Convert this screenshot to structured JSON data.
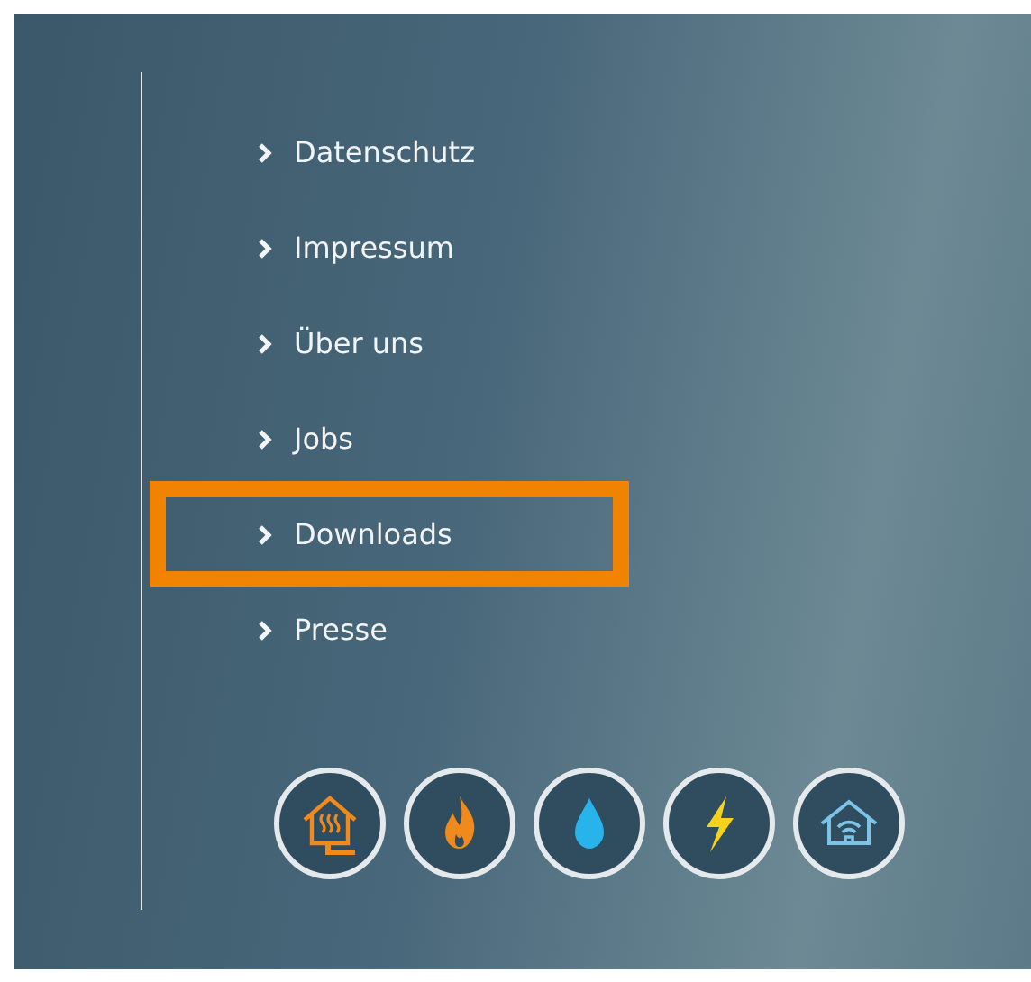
{
  "footer_links": [
    {
      "label": "Datenschutz",
      "highlighted": false
    },
    {
      "label": "Impressum",
      "highlighted": false
    },
    {
      "label": "Über uns",
      "highlighted": false
    },
    {
      "label": "Jobs",
      "highlighted": false
    },
    {
      "label": "Downloads",
      "highlighted": true
    },
    {
      "label": "Presse",
      "highlighted": false
    }
  ]
}
